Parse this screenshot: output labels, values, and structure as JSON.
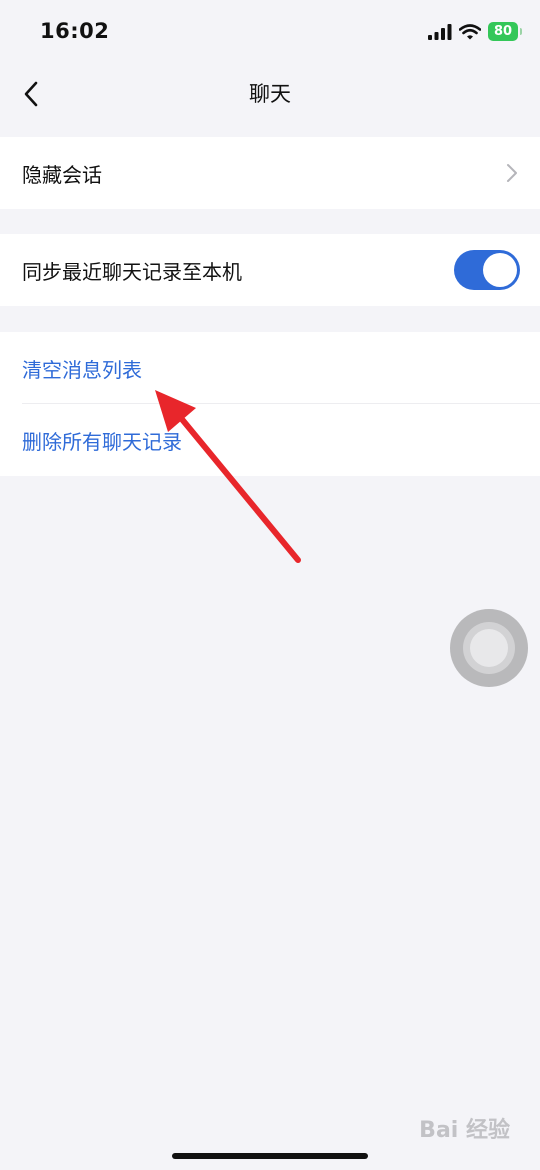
{
  "status_bar": {
    "time": "16:02",
    "battery": "80"
  },
  "nav": {
    "title": "聊天",
    "back_icon": "chevron-left-icon"
  },
  "groups": [
    {
      "items": [
        {
          "label": "隐藏会话",
          "accessory": "chevron-right-icon"
        }
      ]
    },
    {
      "items": [
        {
          "label": "同步最近聊天记录至本机",
          "accessory": "toggle",
          "toggle_on": true
        }
      ]
    },
    {
      "items": [
        {
          "label": "清空消息列表"
        },
        {
          "label": "删除所有聊天记录"
        }
      ]
    }
  ],
  "colors": {
    "accent": "#2f6bd8",
    "background": "#f4f4f8",
    "annotation_arrow": "#e8262b",
    "battery": "#34c759"
  }
}
